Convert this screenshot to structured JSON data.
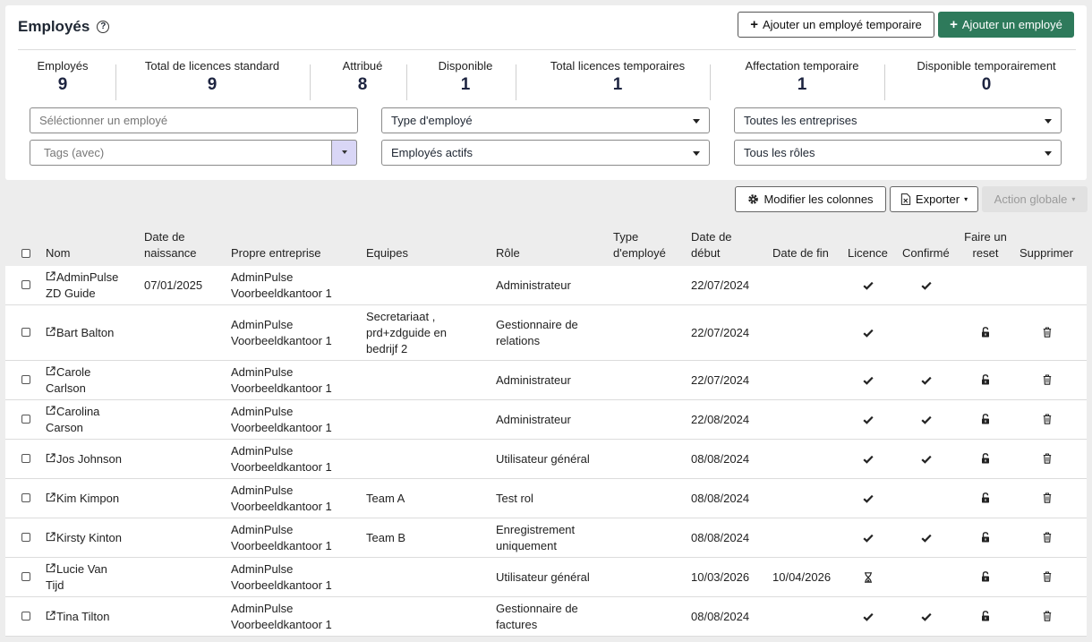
{
  "header": {
    "title": "Employés",
    "add_temp_label": "Ajouter un employé temporaire",
    "add_employee_label": "Ajouter un employé"
  },
  "stats": [
    {
      "label": "Employés",
      "value": "9"
    },
    {
      "label": "Total de licences standard",
      "value": "9"
    },
    {
      "label": "Attribué",
      "value": "8"
    },
    {
      "label": "Disponible",
      "value": "1"
    },
    {
      "label": "Total licences temporaires",
      "value": "1"
    },
    {
      "label": "Affectation temporaire",
      "value": "1"
    },
    {
      "label": "Disponible temporairement",
      "value": "0"
    }
  ],
  "filters": {
    "employee_placeholder": "Séléctionner un employé",
    "employee_type": "Type d'employé",
    "companies": "Toutes les entreprises",
    "tags_placeholder": "Tags (avec)",
    "active": "Employés actifs",
    "roles": "Tous les rôles"
  },
  "toolbar": {
    "columns_label": "Modifier les colonnes",
    "export_label": "Exporter",
    "global_action_label": "Action globale"
  },
  "columns": {
    "name": "Nom",
    "birth_l1": "Date de",
    "birth_l2": "naissance",
    "company": "Propre entreprise",
    "teams": "Equipes",
    "role": "Rôle",
    "type_l1": "Type",
    "type_l2": "d'employé",
    "start_l1": "Date de",
    "start_l2": "début",
    "end": "Date de fin",
    "license": "Licence",
    "confirmed": "Confirmé",
    "reset_l1": "Faire un",
    "reset_l2": "reset",
    "delete": "Supprimer"
  },
  "rows": [
    {
      "name_l1": "AdminPulse",
      "name_l2": "ZD Guide",
      "birth": "07/01/2025",
      "company_l1": "AdminPulse",
      "company_l2": "Voorbeeldkantoor 1",
      "teams": [
        "",
        "",
        ""
      ],
      "role_l1": "Administrateur",
      "role_l2": "",
      "start": "22/07/2024",
      "end": "",
      "license": "check",
      "confirmed": true,
      "reset": false,
      "delete": false
    },
    {
      "name_l1": "Bart Balton",
      "name_l2": "",
      "birth": "",
      "company_l1": "AdminPulse",
      "company_l2": "Voorbeeldkantoor 1",
      "teams": [
        "Secretariaat ,",
        "prd+zdguide en",
        "bedrijf 2"
      ],
      "role_l1": "Gestionnaire de",
      "role_l2": "relations",
      "start": "22/07/2024",
      "end": "",
      "license": "check",
      "confirmed": false,
      "reset": true,
      "delete": true
    },
    {
      "name_l1": "Carole",
      "name_l2": "Carlson",
      "birth": "",
      "company_l1": "AdminPulse",
      "company_l2": "Voorbeeldkantoor 1",
      "teams": [
        "",
        "",
        ""
      ],
      "role_l1": "Administrateur",
      "role_l2": "",
      "start": "22/07/2024",
      "end": "",
      "license": "check",
      "confirmed": true,
      "reset": true,
      "delete": true
    },
    {
      "name_l1": "Carolina",
      "name_l2": "Carson",
      "birth": "",
      "company_l1": "AdminPulse",
      "company_l2": "Voorbeeldkantoor 1",
      "teams": [
        "",
        "",
        ""
      ],
      "role_l1": "Administrateur",
      "role_l2": "",
      "start": "22/08/2024",
      "end": "",
      "license": "check",
      "confirmed": true,
      "reset": true,
      "delete": true
    },
    {
      "name_l1": "Jos Johnson",
      "name_l2": "",
      "birth": "",
      "company_l1": "AdminPulse",
      "company_l2": "Voorbeeldkantoor 1",
      "teams": [
        "",
        "",
        ""
      ],
      "role_l1": "Utilisateur général",
      "role_l2": "",
      "start": "08/08/2024",
      "end": "",
      "license": "check",
      "confirmed": true,
      "reset": true,
      "delete": true
    },
    {
      "name_l1": "Kim Kimpon",
      "name_l2": "",
      "birth": "",
      "company_l1": "AdminPulse",
      "company_l2": "Voorbeeldkantoor 1",
      "teams": [
        "Team A",
        "",
        ""
      ],
      "role_l1": "Test rol",
      "role_l2": "",
      "start": "08/08/2024",
      "end": "",
      "license": "check",
      "confirmed": false,
      "reset": true,
      "delete": true
    },
    {
      "name_l1": "Kirsty Kinton",
      "name_l2": "",
      "birth": "",
      "company_l1": "AdminPulse",
      "company_l2": "Voorbeeldkantoor 1",
      "teams": [
        "Team B",
        "",
        ""
      ],
      "role_l1": "Enregistrement",
      "role_l2": "uniquement",
      "start": "08/08/2024",
      "end": "",
      "license": "check",
      "confirmed": true,
      "reset": true,
      "delete": true
    },
    {
      "name_l1": "Lucie Van",
      "name_l2": "Tijd",
      "birth": "",
      "company_l1": "AdminPulse",
      "company_l2": "Voorbeeldkantoor 1",
      "teams": [
        "",
        "",
        ""
      ],
      "role_l1": "Utilisateur général",
      "role_l2": "",
      "start": "10/03/2026",
      "end": "10/04/2026",
      "license": "hourglass",
      "confirmed": false,
      "reset": true,
      "delete": true
    },
    {
      "name_l1": "Tina Tilton",
      "name_l2": "",
      "birth": "",
      "company_l1": "AdminPulse",
      "company_l2": "Voorbeeldkantoor 1",
      "teams": [
        "",
        "",
        ""
      ],
      "role_l1": "Gestionnaire de",
      "role_l2": "factures",
      "start": "08/08/2024",
      "end": "",
      "license": "check",
      "confirmed": true,
      "reset": true,
      "delete": true
    }
  ],
  "icons": {
    "help": "question-circle-icon",
    "external": "external-link-icon",
    "license": "check-icon",
    "temporary": "hourglass-icon",
    "reset": "unlock-icon",
    "delete": "trash-icon",
    "settings": "gear-icon",
    "export": "excel-file-icon"
  },
  "colors": {
    "primary": "#2e7a5b",
    "tags_caret_bg": "#d9d6f6",
    "stat_value": "#1d2440"
  }
}
